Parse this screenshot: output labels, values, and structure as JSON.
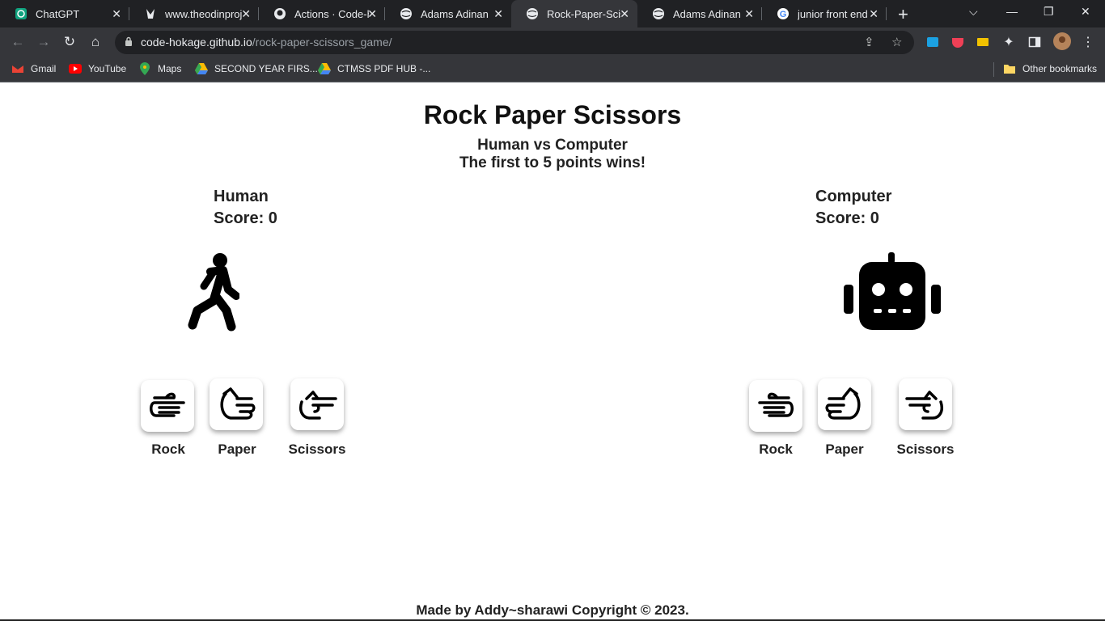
{
  "browser": {
    "tabs": [
      {
        "title": "ChatGPT",
        "icon": "chatgpt-icon"
      },
      {
        "title": "www.theodinproj",
        "icon": "odin-icon"
      },
      {
        "title": "Actions · Code-h",
        "icon": "github-icon"
      },
      {
        "title": "Adams Adinan",
        "icon": "globe-icon"
      },
      {
        "title": "Rock-Paper-Sciss",
        "icon": "globe-icon",
        "active": true
      },
      {
        "title": "Adams Adinan",
        "icon": "globe-icon"
      },
      {
        "title": "junior front end d",
        "icon": "google-icon"
      }
    ],
    "url_host": "code-hokage.github.io",
    "url_path": "/rock-paper-scissors_game/",
    "bookmarks": [
      {
        "label": "Gmail",
        "icon": "gmail-icon"
      },
      {
        "label": "YouTube",
        "icon": "youtube-icon"
      },
      {
        "label": "Maps",
        "icon": "maps-icon"
      },
      {
        "label": "SECOND YEAR FIRS...",
        "icon": "drive-icon"
      },
      {
        "label": "CTMSS PDF HUB -...",
        "icon": "drive-icon"
      }
    ],
    "other_bookmarks": "Other bookmarks"
  },
  "game": {
    "title": "Rock Paper Scissors",
    "subtitle": "Human vs Computer",
    "rules": "The first to 5 points wins!",
    "human": {
      "name": "Human",
      "score_label": "Score: 0",
      "avatar": "walking-person-icon",
      "choices": [
        "Rock",
        "Paper",
        "Scissors"
      ]
    },
    "computer": {
      "name": "Computer",
      "score_label": "Score: 0",
      "avatar": "robot-icon",
      "choices": [
        "Rock",
        "Paper",
        "Scissors"
      ]
    }
  },
  "footer": "Made by Addy~sharawi Copyright © 2023.",
  "colors": {
    "chrome_dark": "#202124",
    "chrome_bar": "#35363a",
    "text": "#222222"
  }
}
